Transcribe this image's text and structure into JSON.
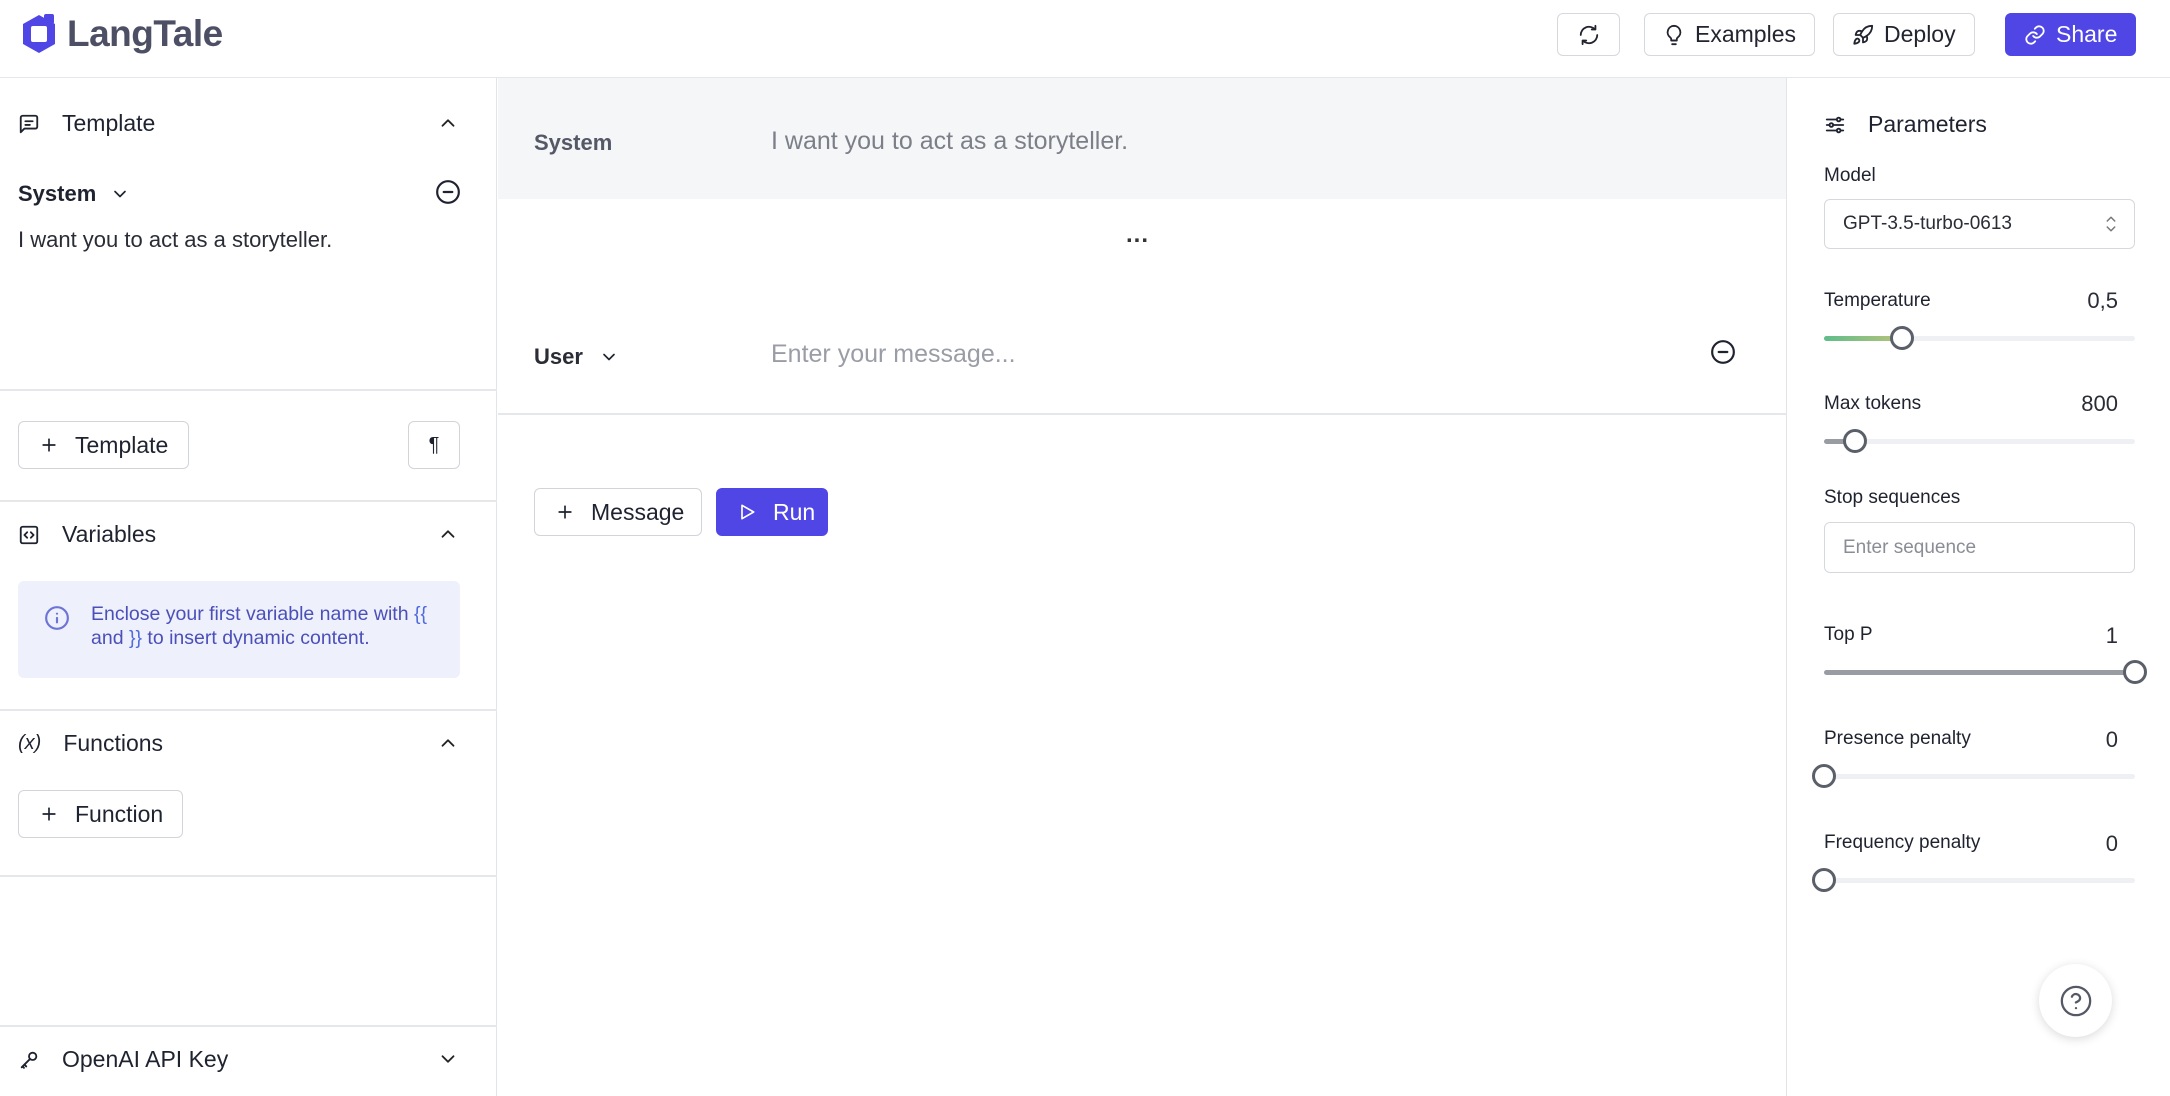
{
  "app": {
    "name": "LangTale"
  },
  "header": {
    "examples_label": "Examples",
    "deploy_label": "Deploy",
    "share_label": "Share"
  },
  "sidebar": {
    "template": {
      "title": "Template",
      "role": "System",
      "text": "I want you to act as a storyteller.",
      "add_label": "Template",
      "format_symbol": "¶"
    },
    "variables": {
      "title": "Variables",
      "note_prefix": "Enclose your first variable name with",
      "open_brace": "{{",
      "note_and": "and",
      "close_brace": "}}",
      "note_suffix": "to insert dynamic content."
    },
    "functions": {
      "title": "Functions",
      "add_label": "Function"
    },
    "api_key": {
      "title": "OpenAI API Key"
    }
  },
  "messages": {
    "system": {
      "role": "System",
      "text": "I want you to act as a storyteller."
    },
    "ellipsis": "...",
    "user": {
      "role": "User",
      "placeholder": "Enter your message..."
    },
    "add_label": "Message",
    "run_label": "Run"
  },
  "parameters": {
    "title": "Parameters",
    "model_label": "Model",
    "model_value": "GPT-3.5-turbo-0613",
    "temperature": {
      "label": "Temperature",
      "value": "0,5",
      "fraction": 0.25
    },
    "max_tokens": {
      "label": "Max tokens",
      "value": "800",
      "fraction": 0.1
    },
    "stop_sequences": {
      "label": "Stop sequences",
      "placeholder": "Enter sequence"
    },
    "top_p": {
      "label": "Top P",
      "value": "1",
      "fraction": 1
    },
    "presence_penalty": {
      "label": "Presence penalty",
      "value": "0",
      "fraction": 0
    },
    "frequency_penalty": {
      "label": "Frequency penalty",
      "value": "0",
      "fraction": 0
    }
  },
  "colors": {
    "accent": "#4f46e5",
    "note_bg": "#eef0fc",
    "temperature_fill_start": "#5fbd8a",
    "temperature_fill_end": "#b8c37a"
  }
}
